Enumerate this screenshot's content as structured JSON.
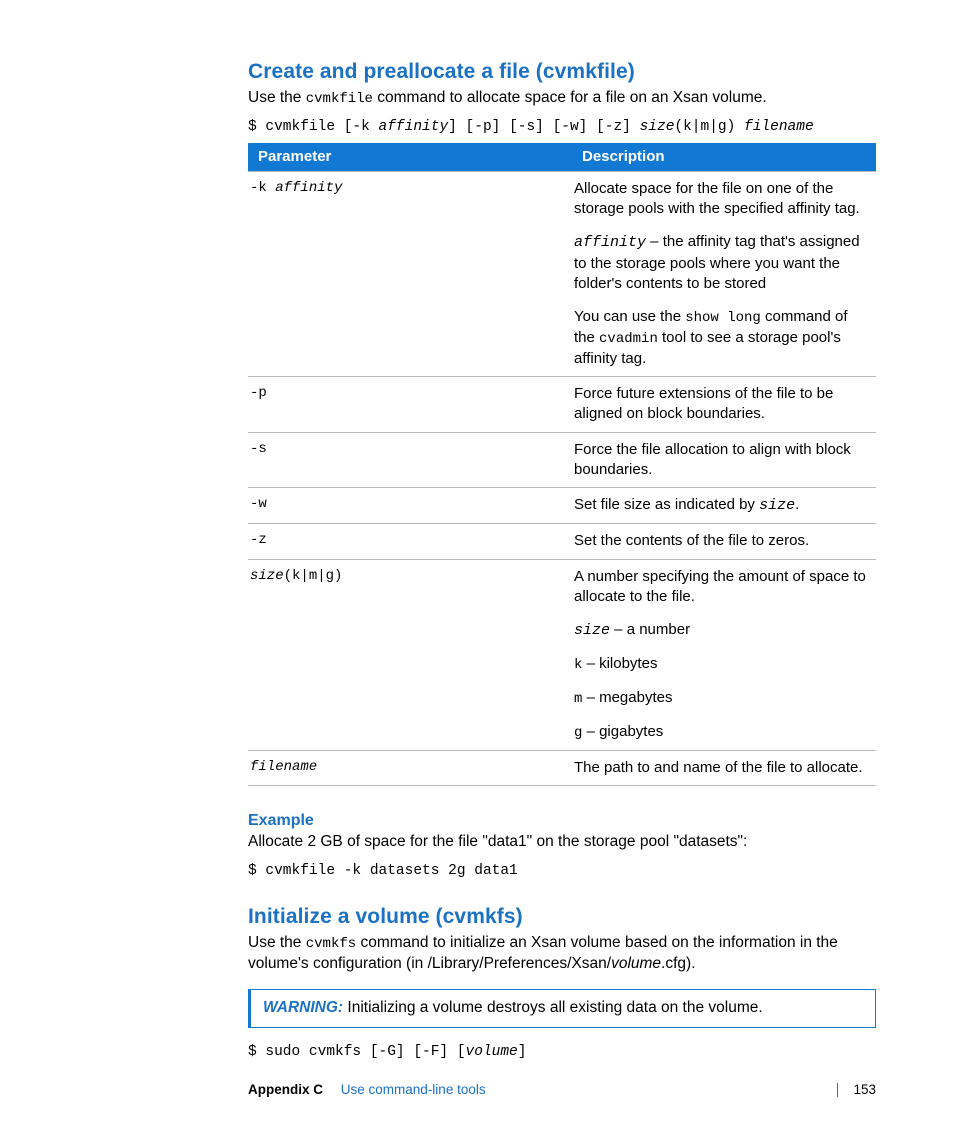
{
  "section1": {
    "heading": "Create and preallocate a file (cvmkfile)",
    "intro_pre": "Use the ",
    "intro_code": "cvmkfile",
    "intro_post": " command to allocate space for a file on an Xsan volume.",
    "cmd_prefix": "$ cvmkfile [-k ",
    "cmd_aff": "affinity",
    "cmd_mid": "] [-p] [-s] [-w] [-z] ",
    "cmd_size": "size",
    "cmd_units": "(k|m|g) ",
    "cmd_fname": "filename"
  },
  "table": {
    "h1": "Parameter",
    "h2": "Description",
    "rows": {
      "r1p_a": "-k ",
      "r1p_b": "affinity",
      "r1a": "Allocate space for the file on one of the storage pools with the specified affinity tag.",
      "r1b_code": "affinity",
      "r1b_rest": " – the affinity tag that's assigned to the storage pools where you want the folder's contents to be stored",
      "r1c_a": "You can use the ",
      "r1c_code1": "show long",
      "r1c_b": " command of the ",
      "r1c_code2": "cvadmin",
      "r1c_c": " tool to see a storage pool's affinity tag.",
      "r2p": "-p",
      "r2d": "Force future extensions of the file to be aligned on block boundaries.",
      "r3p": "-s",
      "r3d": "Force the file allocation to align with block boundaries.",
      "r4p": "-w",
      "r4d_a": "Set file size as indicated by ",
      "r4d_code": "size",
      "r4d_b": ".",
      "r5p": "-z",
      "r5d": "Set the contents of the file to zeros.",
      "r6p": "size",
      "r6p_units": "(k|m|g)",
      "r6a": "A number specifying the amount of space to allocate to the file.",
      "r6b_code": "size",
      "r6b_rest": " – a number",
      "r6c_code": "k",
      "r6c_rest": " – kilobytes",
      "r6d_code": "m",
      "r6d_rest": " – megabytes",
      "r6e_code": "g",
      "r6e_rest": " – gigabytes",
      "r7p": "filename",
      "r7d": "The path to and name of the file to allocate."
    }
  },
  "example": {
    "heading": "Example",
    "text": "Allocate 2 GB of space for the file \"data1\" on the storage pool \"datasets\":",
    "cmd": "$ cvmkfile -k datasets 2g data1"
  },
  "section2": {
    "heading": "Initialize a volume (cvmkfs)",
    "intro_pre": "Use the ",
    "intro_code": "cvmkfs",
    "intro_mid": " command to initialize an Xsan volume based on the information in the volume's configuration (in /Library/Preferences/Xsan/",
    "intro_ital": "volume",
    "intro_post": ".cfg).",
    "warn_label": "WARNING:  ",
    "warn_text": "Initializing a volume destroys all existing data on the volume.",
    "cmd_a": "$ sudo cvmkfs [-G] [-F] [",
    "cmd_vol": "volume",
    "cmd_b": "]"
  },
  "footer": {
    "appendix": "Appendix C",
    "chapter": "Use command-line tools",
    "page": "153"
  }
}
